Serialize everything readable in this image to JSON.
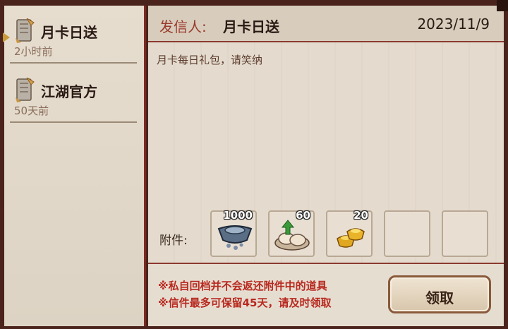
{
  "mail_list": [
    {
      "title": "月卡日送",
      "time": "2小时前",
      "selected": true
    },
    {
      "title": "江湖官方",
      "time": "50天前",
      "selected": false
    }
  ],
  "header": {
    "sender_label": "发信人:",
    "sender_name": "月卡日送",
    "date": "2023/11/9"
  },
  "body": {
    "text": "月卡每日礼包，请笑纳"
  },
  "attachments": {
    "label": "附件:",
    "items": [
      {
        "icon": "silver-ingot-icon",
        "count": "1000"
      },
      {
        "icon": "buns-icon",
        "count": "60"
      },
      {
        "icon": "gold-ingot-icon",
        "count": "20"
      },
      {
        "icon": "empty-slot",
        "count": ""
      },
      {
        "icon": "empty-slot",
        "count": ""
      }
    ]
  },
  "footer": {
    "note1": "※私自回档并不会返还附件中的道具",
    "note2": "※信件最多可保留45天，请及时领取",
    "claim_label": "领取"
  },
  "colors": {
    "frame": "#4a231c",
    "accent_red": "#b8281e",
    "paper": "#e3dace"
  }
}
